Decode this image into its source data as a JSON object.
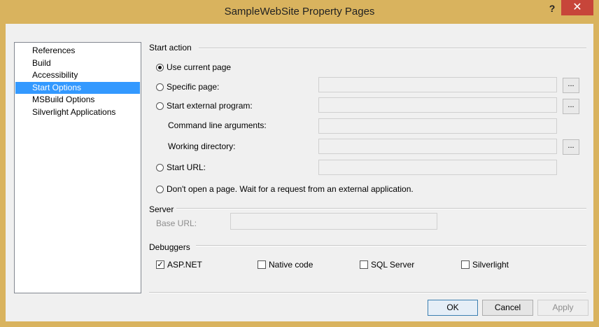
{
  "window": {
    "title": "SampleWebSite Property Pages",
    "help_label": "?",
    "close_label": "✕"
  },
  "nav": {
    "items": [
      {
        "label": "References"
      },
      {
        "label": "Build"
      },
      {
        "label": "Accessibility"
      },
      {
        "label": "Start Options",
        "selected": true
      },
      {
        "label": "MSBuild Options"
      },
      {
        "label": "Silverlight Applications"
      }
    ]
  },
  "start_action": {
    "group_label": "Start action",
    "use_current_page": "Use current page",
    "specific_page": "Specific page:",
    "start_external_program": "Start external program:",
    "command_line_arguments": "Command line arguments:",
    "working_directory": "Working directory:",
    "start_url": "Start URL:",
    "dont_open": "Don't open a page. Wait for a request from an external application.",
    "browse_label": "...",
    "selected_option": "use_current_page"
  },
  "server": {
    "group_label": "Server",
    "base_url_label": "Base URL:"
  },
  "debuggers": {
    "group_label": "Debuggers",
    "aspnet": {
      "label": "ASP.NET",
      "checked": true
    },
    "native": {
      "label": "Native code",
      "checked": false
    },
    "sql": {
      "label": "SQL Server",
      "checked": false
    },
    "silverlight": {
      "label": "Silverlight",
      "checked": false
    }
  },
  "buttons": {
    "ok": "OK",
    "cancel": "Cancel",
    "apply": "Apply"
  }
}
